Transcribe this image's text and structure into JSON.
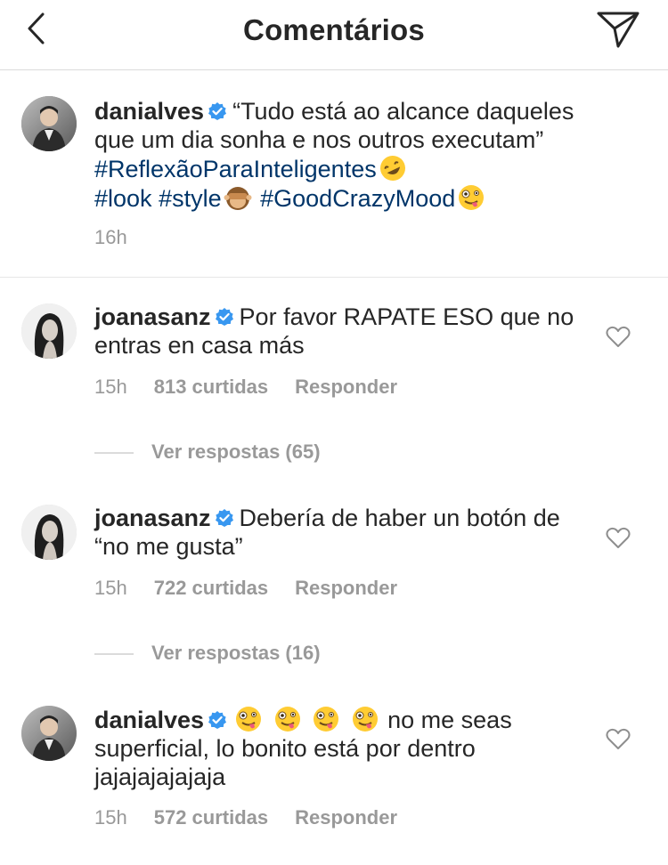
{
  "header": {
    "title": "Comentários"
  },
  "caption": {
    "username": "danialves",
    "text1": "“Tudo está ao alcance daqueles que um dia sonha e nos outros executam” ",
    "hashtag1": "#ReflexãoParaInteligentes",
    "hashtag2": "#look",
    "hashtag3": "#style",
    "hashtag4": "#GoodCrazyMood",
    "time": "16h"
  },
  "comments": [
    {
      "username": "joanasanz",
      "text": "Por favor RAPATE ESO que no entras en casa más",
      "time": "15h",
      "likes": "813 curtidas",
      "reply": "Responder",
      "view_replies": "Ver respostas (65)"
    },
    {
      "username": "joanasanz",
      "text": "Debería de haber un botón de “no me gusta”",
      "time": "15h",
      "likes": "722 curtidas",
      "reply": "Responder",
      "view_replies": "Ver respostas (16)"
    },
    {
      "username": "danialves",
      "text": " no me seas superficial, lo bonito está por dentro jajajajajajaja",
      "time": "15h",
      "likes": "572 curtidas",
      "reply": "Responder"
    }
  ],
  "icons": {
    "back": "chevron-left-icon",
    "send": "paper-plane-icon",
    "verified": "verified-badge-icon",
    "like": "heart-outline-icon"
  },
  "colors": {
    "hashtag": "#003569",
    "verified": "#3897f0",
    "meta": "#999999"
  }
}
